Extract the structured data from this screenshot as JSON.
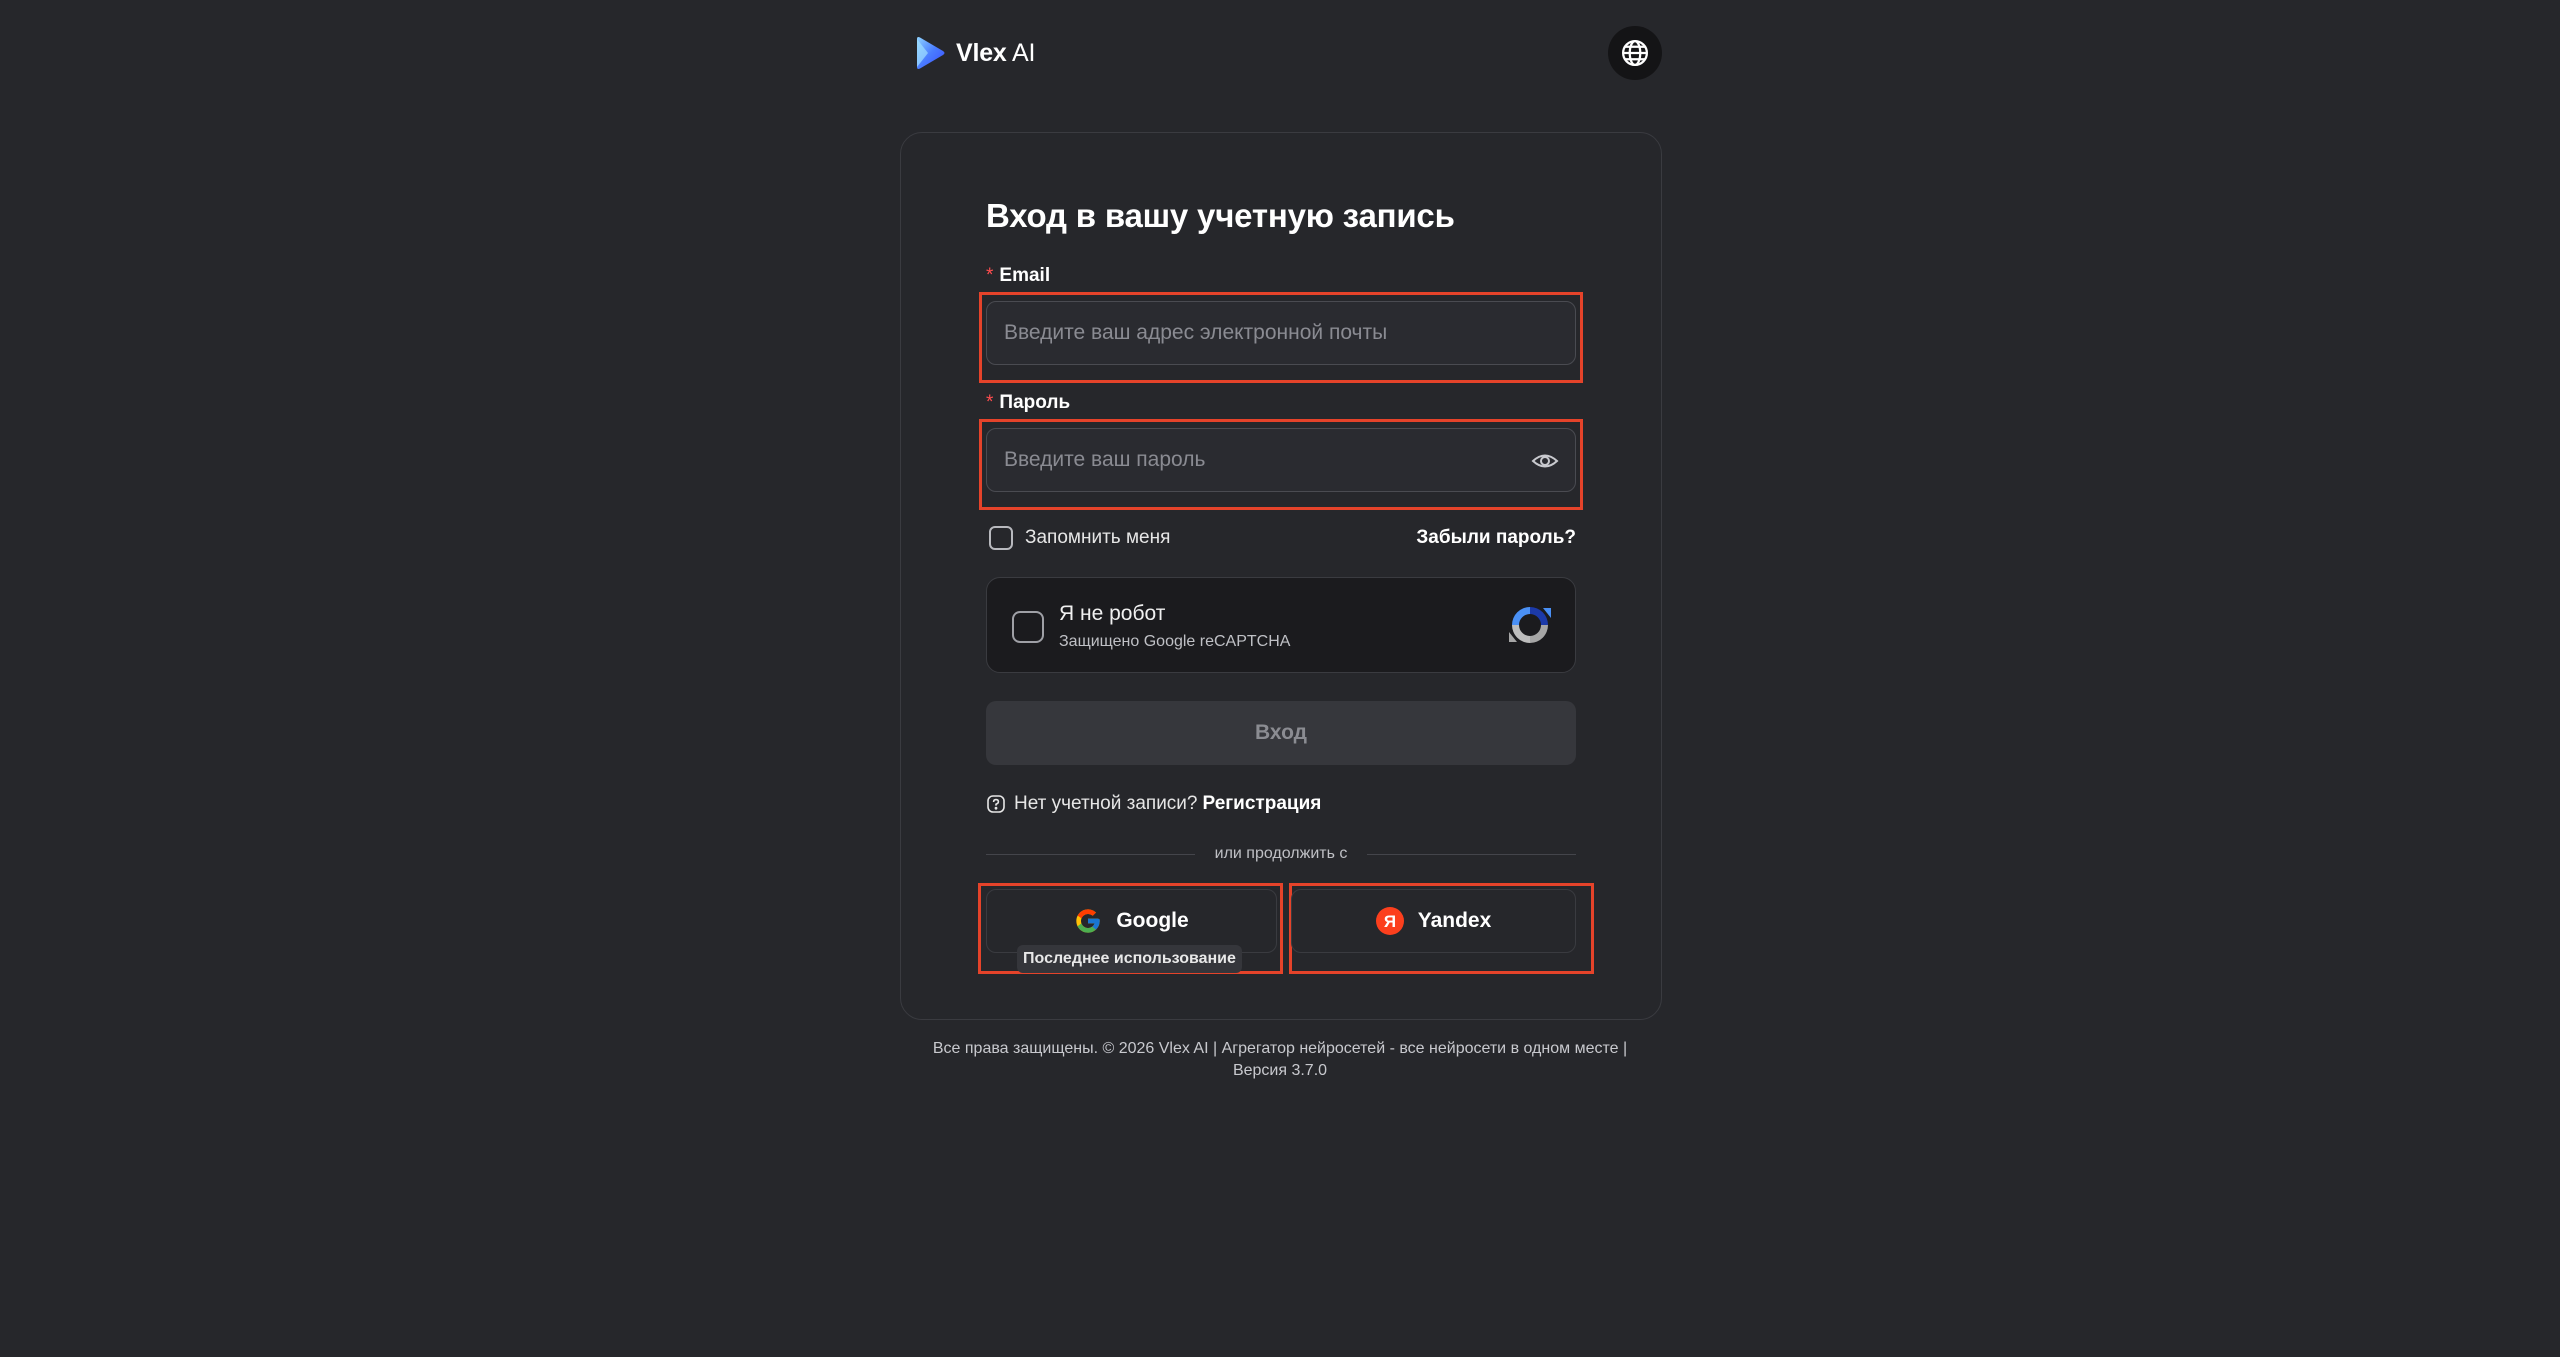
{
  "header": {
    "brand_name": "Vlex",
    "brand_suffix": "AI",
    "logo_icon": "vlex-play-logo",
    "language_icon": "globe-icon"
  },
  "login": {
    "title": "Вход в вашу учетную запись",
    "email": {
      "label": "Email",
      "placeholder": "Введите ваш адрес электронной почты",
      "value": ""
    },
    "password": {
      "label": "Пароль",
      "placeholder": "Введите ваш пароль",
      "value": "",
      "toggle_icon": "eye-icon"
    },
    "required_mark": "*",
    "remember_label": "Запомнить меня",
    "forgot_label": "Забыли пароль?",
    "captcha": {
      "title": "Я не робот",
      "subtitle": "Защищено Google reCAPTCHA"
    },
    "submit_label": "Вход",
    "no_account_text": "Нет учетной записи?",
    "register_label": "Регистрация",
    "divider_text": "или продолжить с",
    "google_label": "Google",
    "yandex_label": "Yandex",
    "yandex_glyph": "Я",
    "last_used_badge": "Последнее использование"
  },
  "footer": {
    "line1": "Все права защищены. © 2026 Vlex AI | Агрегатор нейросетей - все нейросети в одном месте |",
    "line2": "Версия 3.7.0"
  },
  "colors": {
    "background": "#26272b",
    "highlight": "#e5432a",
    "required": "#ff4d4f",
    "yandex": "#fc3f1d"
  }
}
